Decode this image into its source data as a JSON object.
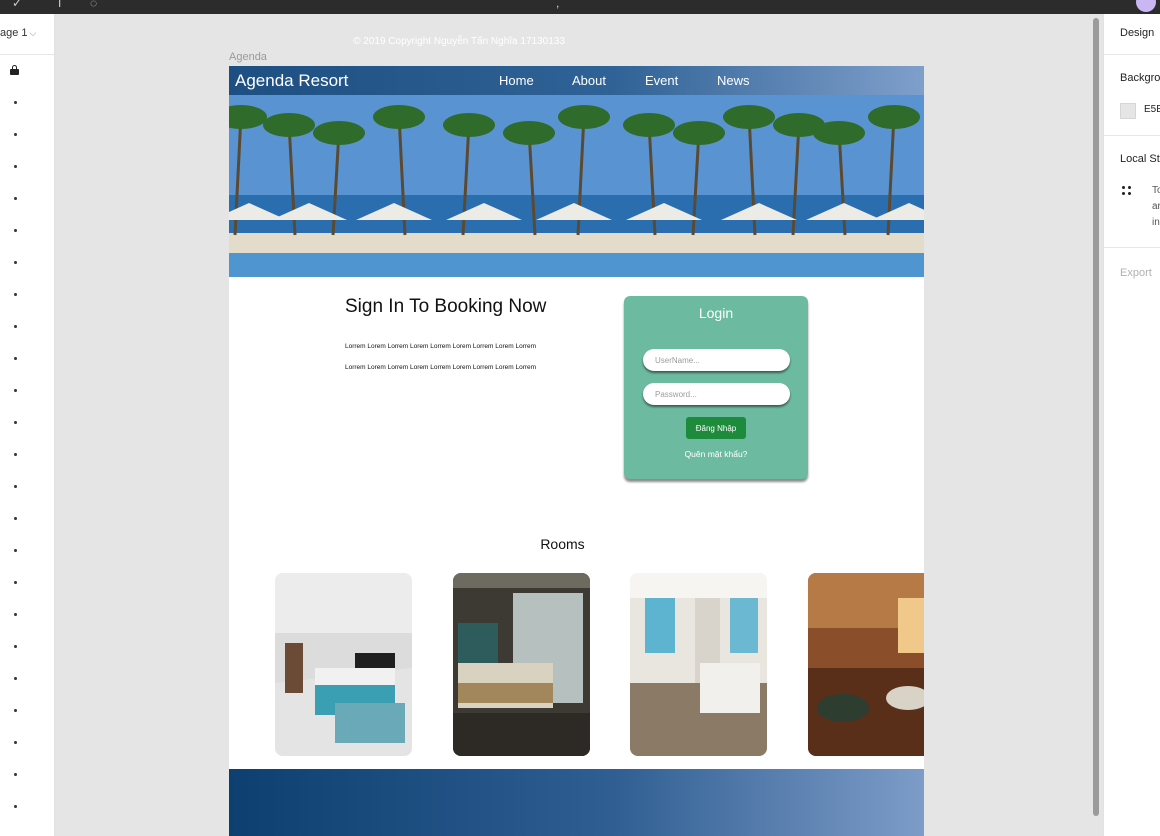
{
  "editor": {
    "page_selector": "age 1",
    "frame_name": "Agenda",
    "right_panel": {
      "tab": "Design",
      "background_label": "Backgrou",
      "background_hex": "E5E",
      "local_styles_label": "Local St",
      "local_styles_text": [
        "To",
        "ar",
        "in"
      ],
      "export_label": "Export"
    }
  },
  "site": {
    "brand": "Agenda Resort",
    "nav": [
      "Home",
      "About",
      "Event",
      "News"
    ],
    "signin_title": "Sign In To Booking Now",
    "lorem_lines": [
      "Lorrem Lorem Lorrem Lorem Lorrem Lorem Lorrem Lorem Lorrem",
      "Lorrem Lorem Lorrem Lorem Lorrem Lorem Lorrem Lorem Lorrem"
    ],
    "login": {
      "title": "Login",
      "username_placeholder": "UserName...",
      "password_placeholder": "Password...",
      "submit": "Đăng Nhập",
      "forgot": "Quên mật khẩu?"
    },
    "rooms_title": "Rooms",
    "footer": "© 2019 Copyright Nguyễn Tấn Nghĩa 17130133"
  },
  "colors": {
    "canvas": "#e5e5e5",
    "nav_start": "#1e4f83",
    "nav_end": "#7f9fcb",
    "login_card": "#6cbba1",
    "login_button": "#1e8a3c",
    "footer_start": "#0d3f70",
    "footer_end": "#7d9cc8"
  }
}
